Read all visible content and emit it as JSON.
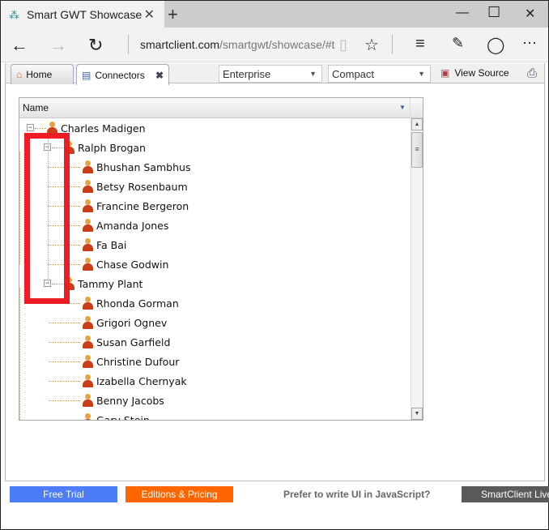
{
  "browser": {
    "tab_title": "Smart GWT Showcase",
    "url_host": "smartclient.com",
    "url_path": "/smartgwt/showcase/#t"
  },
  "toolbar": {
    "tabs": [
      {
        "label": "Home",
        "icon": "home-icon"
      },
      {
        "label": "Connectors",
        "icon": "list-icon"
      }
    ],
    "skin": "Enterprise",
    "density": "Compact",
    "view_source": "View Source"
  },
  "grid": {
    "column": "Name",
    "rows": [
      {
        "name": "Charles Madigen",
        "level": 0,
        "expanded": true
      },
      {
        "name": "Ralph Brogan",
        "level": 1,
        "expanded": true
      },
      {
        "name": "Bhushan Sambhus",
        "level": 2
      },
      {
        "name": "Betsy Rosenbaum",
        "level": 2
      },
      {
        "name": "Francine Bergeron",
        "level": 2
      },
      {
        "name": "Amanda Jones",
        "level": 2
      },
      {
        "name": "Fa Bai",
        "level": 2
      },
      {
        "name": "Chase Godwin",
        "level": 2
      },
      {
        "name": "Tammy Plant",
        "level": 1,
        "expanded": true
      },
      {
        "name": "Rhonda Gorman",
        "level": 2
      },
      {
        "name": "Grigori Ognev",
        "level": 2
      },
      {
        "name": "Susan Garfield",
        "level": 2
      },
      {
        "name": "Christine Dufour",
        "level": 2
      },
      {
        "name": "Izabella Chernyak",
        "level": 2
      },
      {
        "name": "Benny Jacobs",
        "level": 2
      },
      {
        "name": "Gary Stein",
        "level": 2
      }
    ]
  },
  "footer": {
    "free_trial": "Free Trial",
    "editions": "Editions & Pricing",
    "prefer": "Prefer to write UI in JavaScript?",
    "smartclient": "SmartClient Live"
  },
  "colors": {
    "free_trial": "#4d7cf7",
    "editions": "#ff6600",
    "smartclient": "#5a5a5a",
    "highlight": "#ee1c24"
  }
}
